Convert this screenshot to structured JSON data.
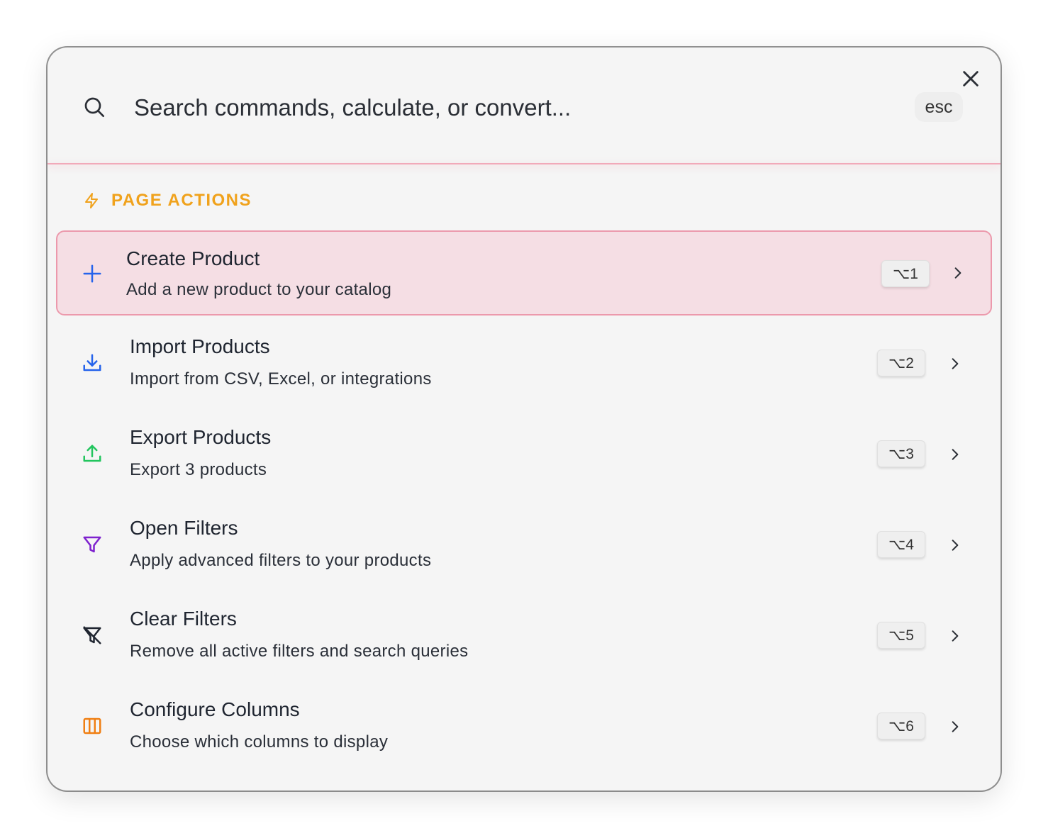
{
  "search": {
    "placeholder": "Search commands, calculate, or convert...",
    "esc_label": "esc"
  },
  "section": {
    "title": "PAGE ACTIONS",
    "accent_color": "#f0a21c"
  },
  "items": [
    {
      "title": "Create Product",
      "description": "Add a new product to your catalog",
      "shortcut": "⌥1",
      "icon": "plus-icon",
      "icon_color": "#2563eb",
      "selected": true
    },
    {
      "title": "Import Products",
      "description": "Import from CSV, Excel, or integrations",
      "shortcut": "⌥2",
      "icon": "download-icon",
      "icon_color": "#2563eb",
      "selected": false
    },
    {
      "title": "Export Products",
      "description": "Export 3 products",
      "shortcut": "⌥3",
      "icon": "upload-icon",
      "icon_color": "#22c55e",
      "selected": false
    },
    {
      "title": "Open Filters",
      "description": "Apply advanced filters to your products",
      "shortcut": "⌥4",
      "icon": "filter-icon",
      "icon_color": "#7e22ce",
      "selected": false
    },
    {
      "title": "Clear Filters",
      "description": "Remove all active filters and search queries",
      "shortcut": "⌥5",
      "icon": "filter-off-icon",
      "icon_color": "#1f2530",
      "selected": false
    },
    {
      "title": "Configure Columns",
      "description": "Choose which columns to display",
      "shortcut": "⌥6",
      "icon": "columns-icon",
      "icon_color": "#f07f13",
      "selected": false
    }
  ],
  "colors": {
    "selected_bg": "#f5dee4",
    "selected_border": "#ec99ac",
    "divider": "#f1a9b9"
  }
}
